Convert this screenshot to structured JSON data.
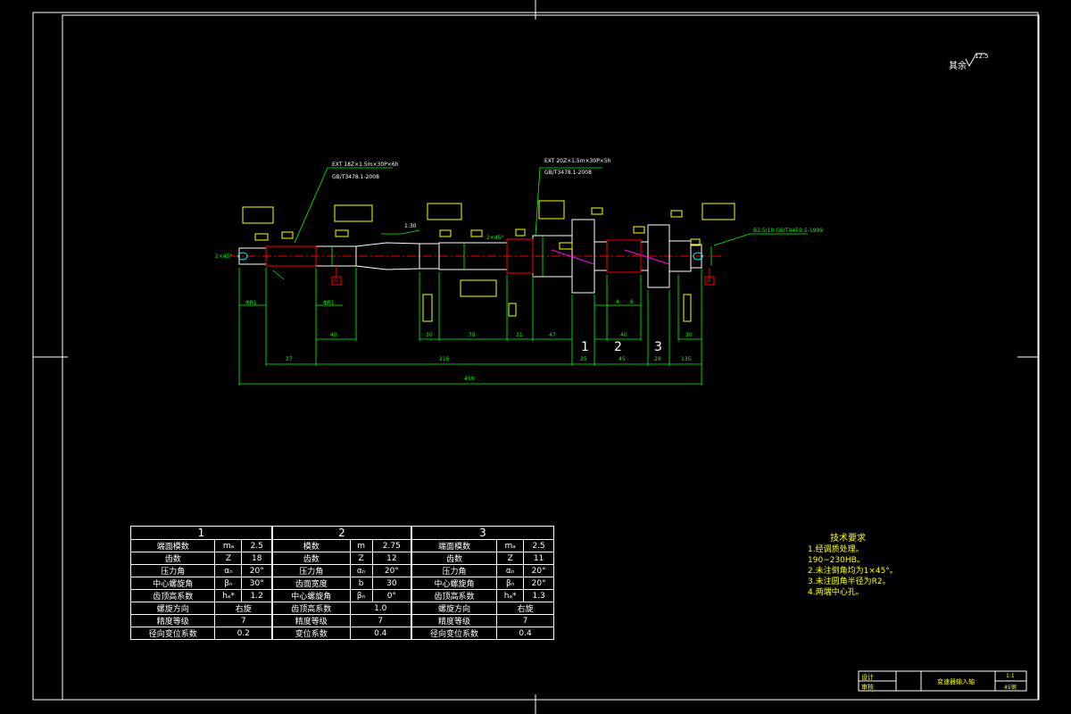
{
  "roughness_note": "其余",
  "roughness_value": "12.5",
  "gear_table": {
    "headers": [
      "1",
      "2",
      "3"
    ],
    "gear1": [
      {
        "name": "端面模数",
        "sym": "mₐ",
        "val": "2.5"
      },
      {
        "name": "齿数",
        "sym": "Z",
        "val": "18"
      },
      {
        "name": "压力角",
        "sym": "αₙ",
        "val": "20°"
      },
      {
        "name": "中心螺旋角",
        "sym": "βₙ",
        "val": "30°"
      },
      {
        "name": "齿顶高系数",
        "sym": "hₐ*",
        "val": "1.2"
      },
      {
        "name": "螺旋方向",
        "sym": "",
        "val": "右旋"
      },
      {
        "name": "精度等级",
        "sym": "",
        "val": "7"
      },
      {
        "name": "径向变位系数",
        "sym": "",
        "val": "0.2"
      }
    ],
    "gear2": [
      {
        "name": "模数",
        "sym": "m",
        "val": "2.75"
      },
      {
        "name": "齿数",
        "sym": "Z",
        "val": "12"
      },
      {
        "name": "压力角",
        "sym": "αₙ",
        "val": "20°"
      },
      {
        "name": "齿面宽度",
        "sym": "b",
        "val": "30"
      },
      {
        "name": "中心螺旋角",
        "sym": "βₙ",
        "val": "0°"
      },
      {
        "name": "齿顶高系数",
        "sym": "",
        "val": "1.0"
      },
      {
        "name": "精度等级",
        "sym": "",
        "val": "7"
      },
      {
        "name": "变位系数",
        "sym": "",
        "val": "0.4"
      }
    ],
    "gear3": [
      {
        "name": "端面模数",
        "sym": "mₐ",
        "val": "2.5"
      },
      {
        "name": "齿数",
        "sym": "Z",
        "val": "11"
      },
      {
        "name": "压力角",
        "sym": "αₙ",
        "val": "20°"
      },
      {
        "name": "中心螺旋角",
        "sym": "βₙ",
        "val": "20°"
      },
      {
        "name": "齿顶高系数",
        "sym": "hₐ*",
        "val": "1.3"
      },
      {
        "name": "螺旋方向",
        "sym": "",
        "val": "右旋"
      },
      {
        "name": "精度等级",
        "sym": "",
        "val": "7"
      },
      {
        "name": "径向变位系数",
        "sym": "",
        "val": "0.4"
      }
    ]
  },
  "tech": {
    "title": "技术要求",
    "lines": [
      "1.经调质处理。",
      "190~230HB。",
      "2.未注倒角均为1×45°。",
      "3.未注圆角半径为R2。",
      "4.两端中心孔。"
    ]
  },
  "title_block": {
    "name": "变速器输入轴",
    "design": "设计",
    "check": "审核",
    "scale": "1:1",
    "material": "45钢"
  },
  "labels": {
    "gear_no_1": "1",
    "gear_no_2": "2",
    "gear_no_3": "3",
    "spline1": "EXT 18Z×1.5m×30P×6h",
    "spline1_std": "GB/T3478.1-2008",
    "spline2": "EXT 20Z×1.5m×30P×5h",
    "spline2_std": "GB/T3478.1-2008",
    "center_hole": "B2.5/10 GB/T4459.5-1999",
    "taper": "1:30",
    "dims": {
      "d_total": "450",
      "d_a": "27",
      "d_b": "216",
      "d_c": "25",
      "d_d": "45",
      "d_e": "28",
      "d_f": "135",
      "d_g": "40",
      "d_h": "30",
      "d_i": "78",
      "d_j": "31",
      "d_k": "47",
      "d_l": "40",
      "d_m": "30",
      "d_n": "4",
      "d_o": "6",
      "d_p": "ΦR1",
      "d_q": "ΦR1"
    },
    "datum_a": "A",
    "datum_b": "B",
    "chamfer": "2×45°",
    "chamfer2": "2×45°"
  },
  "colors": {
    "frame": "#ffffff",
    "dim": "#00ff00",
    "tol": "#ffff00",
    "center": "#ff0000",
    "part": "#ffffff",
    "magenta": "#ff00ff"
  }
}
